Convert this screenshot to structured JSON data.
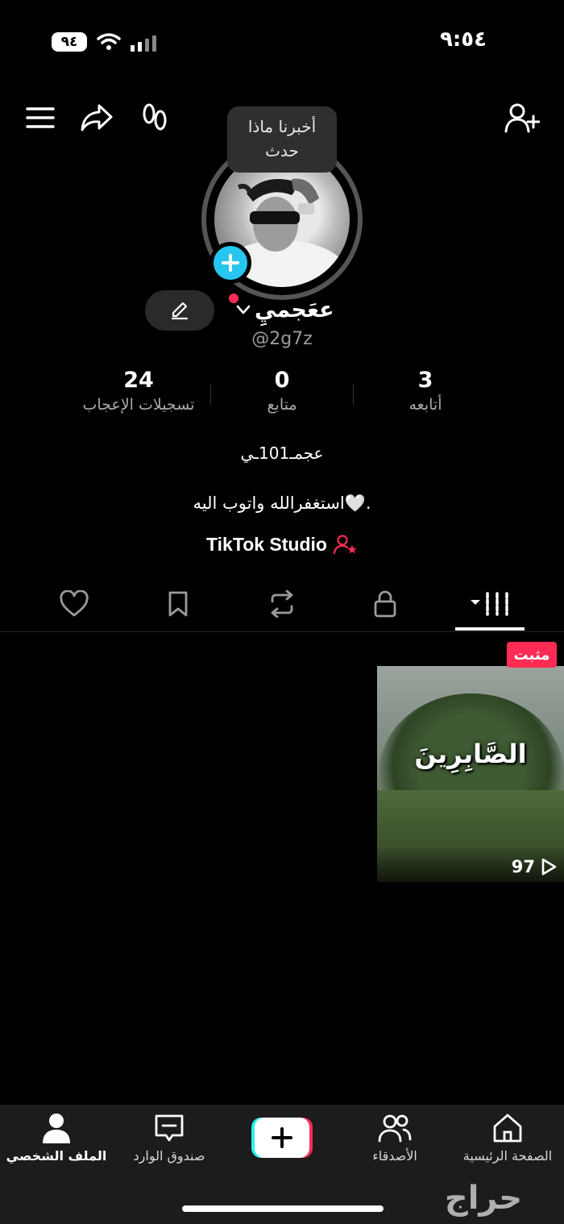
{
  "status_bar": {
    "battery": "٩٤",
    "time": "٩:٥٤",
    "icons": [
      "wifi-icon",
      "signal-icon"
    ]
  },
  "top_bar": {
    "icons": [
      "menu-icon",
      "share-icon",
      "footprints-icon",
      "add-friend-icon"
    ]
  },
  "profile": {
    "tooltip": "أخبرنا ماذا\nحدث",
    "display_name": "ععَجميِ",
    "username": "@2g7z",
    "nickname": "عجمـ101ـي",
    "bio": "استغفرالله واتوب اليه🤍.",
    "studio_label": "TikTok Studio",
    "stats": [
      {
        "value": "3",
        "label": "أتابعه"
      },
      {
        "value": "0",
        "label": "متابع"
      },
      {
        "value": "24",
        "label": "تسجيلات الإعجاب"
      }
    ]
  },
  "tabs": [
    {
      "icon": "videos-grid-icon",
      "active": true
    },
    {
      "icon": "lock-icon",
      "active": false
    },
    {
      "icon": "repost-icon",
      "active": false
    },
    {
      "icon": "bookmark-icon",
      "active": false
    },
    {
      "icon": "heart-icon",
      "active": false
    }
  ],
  "videos": [
    {
      "pinned_label": "مثبت",
      "caption": "الصَّابِرِينَ",
      "views": "97"
    }
  ],
  "bottom_nav": [
    {
      "label": "الصفحة الرئيسية",
      "icon": "home-icon"
    },
    {
      "label": "الأصدقاء",
      "icon": "friends-icon"
    },
    {
      "label": "",
      "icon": "create-plus-icon"
    },
    {
      "label": "صندوق الوارد",
      "icon": "inbox-icon"
    },
    {
      "label": "الملف الشخصي",
      "icon": "profile-icon",
      "active": true
    }
  ],
  "watermark": "حراج",
  "colors": {
    "accent_red": "#fe2c55",
    "accent_cyan": "#26c6f0"
  }
}
